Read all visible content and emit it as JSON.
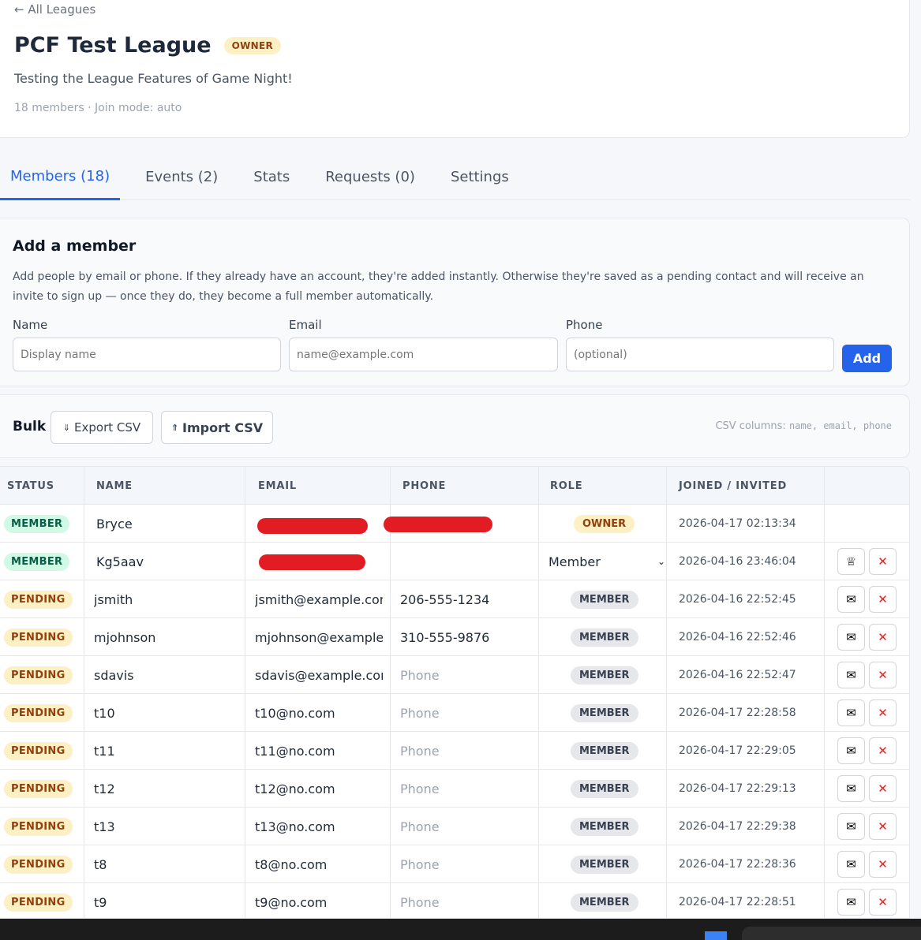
{
  "header": {
    "back_link": "← All Leagues",
    "title": "PCF Test League",
    "role_badge": "OWNER",
    "description": "Testing the League Features of Game Night!",
    "meta": "18 members · Join mode: auto"
  },
  "tabs": [
    {
      "label": "Members (18)",
      "active": true
    },
    {
      "label": "Events (2)"
    },
    {
      "label": "Stats"
    },
    {
      "label": "Requests (0)"
    },
    {
      "label": "Settings"
    }
  ],
  "add_member": {
    "title": "Add a member",
    "description": "Add people by email or phone. If they already have an account, they're added instantly. Otherwise they're saved as a pending contact and will receive an invite to sign up — once they do, they become a full member automatically.",
    "name_label": "Name",
    "name_placeholder": "Display name",
    "email_label": "Email",
    "email_placeholder": "name@example.com",
    "phone_label": "Phone",
    "phone_placeholder": "(optional)",
    "add_button": "Add"
  },
  "bulk": {
    "label": "Bulk",
    "export_button": "Export CSV",
    "import_button": "Import CSV",
    "hint_prefix": "CSV columns: ",
    "hint_cols": [
      "name",
      "email",
      "phone"
    ]
  },
  "table": {
    "columns": [
      "STATUS",
      "NAME",
      "EMAIL",
      "PHONE",
      "ROLE",
      "JOINED / INVITED"
    ],
    "rows": [
      {
        "status": "MEMBER",
        "name": "Bryce",
        "email": "",
        "phone": "",
        "role": "OWNER",
        "joined": "2026-04-17 02:13:34"
      },
      {
        "status": "MEMBER",
        "name": "Kg5aav",
        "email": "",
        "phone": "",
        "role": "Member",
        "joined": "2026-04-16 23:46:04"
      },
      {
        "status": "PENDING",
        "name": "jsmith",
        "email": "jsmith@example.com",
        "phone": "206-555-1234",
        "role": "MEMBER",
        "joined": "2026-04-16 22:52:45"
      },
      {
        "status": "PENDING",
        "name": "mjohnson",
        "email": "mjohnson@example.",
        "phone": "310-555-9876",
        "role": "MEMBER",
        "joined": "2026-04-16 22:52:46"
      },
      {
        "status": "PENDING",
        "name": "sdavis",
        "email": "sdavis@example.com",
        "phone": "Phone",
        "role": "MEMBER",
        "joined": "2026-04-16 22:52:47"
      },
      {
        "status": "PENDING",
        "name": "t10",
        "email": "t10@no.com",
        "phone": "Phone",
        "role": "MEMBER",
        "joined": "2026-04-17 22:28:58"
      },
      {
        "status": "PENDING",
        "name": "t11",
        "email": "t11@no.com",
        "phone": "Phone",
        "role": "MEMBER",
        "joined": "2026-04-17 22:29:05"
      },
      {
        "status": "PENDING",
        "name": "t12",
        "email": "t12@no.com",
        "phone": "Phone",
        "role": "MEMBER",
        "joined": "2026-04-17 22:29:13"
      },
      {
        "status": "PENDING",
        "name": "t13",
        "email": "t13@no.com",
        "phone": "Phone",
        "role": "MEMBER",
        "joined": "2026-04-17 22:29:38"
      },
      {
        "status": "PENDING",
        "name": "t8",
        "email": "t8@no.com",
        "phone": "Phone",
        "role": "MEMBER",
        "joined": "2026-04-17 22:28:36"
      },
      {
        "status": "PENDING",
        "name": "t9",
        "email": "t9@no.com",
        "phone": "Phone",
        "role": "MEMBER",
        "joined": "2026-04-17 22:28:51"
      }
    ]
  },
  "colors": {
    "accent": "#2563eb",
    "member_status": "#065f46",
    "pending_status": "#92400e",
    "danger": "#dc2626"
  },
  "icons": {
    "export": "download-arrow-icon",
    "import": "upload-arrow-icon",
    "resend": "mail-icon",
    "remove": "close-icon",
    "promote": "crown-icon"
  }
}
